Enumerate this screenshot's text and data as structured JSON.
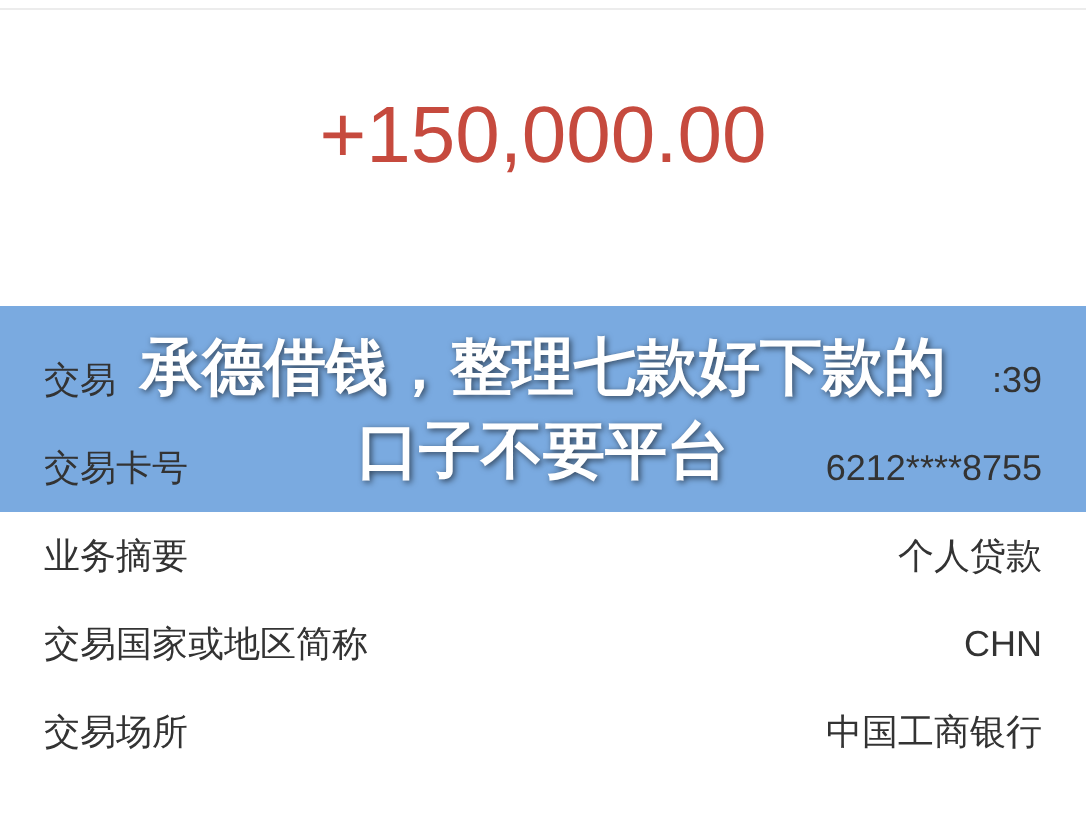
{
  "amount": "+150,000.00",
  "details": [
    {
      "label": "交易",
      "value": ":39"
    },
    {
      "label": "交易卡号",
      "value": "6212****8755"
    },
    {
      "label": "业务摘要",
      "value": "个人贷款"
    },
    {
      "label": "交易国家或地区简称",
      "value": "CHN"
    },
    {
      "label": "交易场所",
      "value": "中国工商银行"
    }
  ],
  "banner": {
    "title_lines": [
      "承德借钱，整理七款好下款的",
      "口子不要平台"
    ]
  }
}
